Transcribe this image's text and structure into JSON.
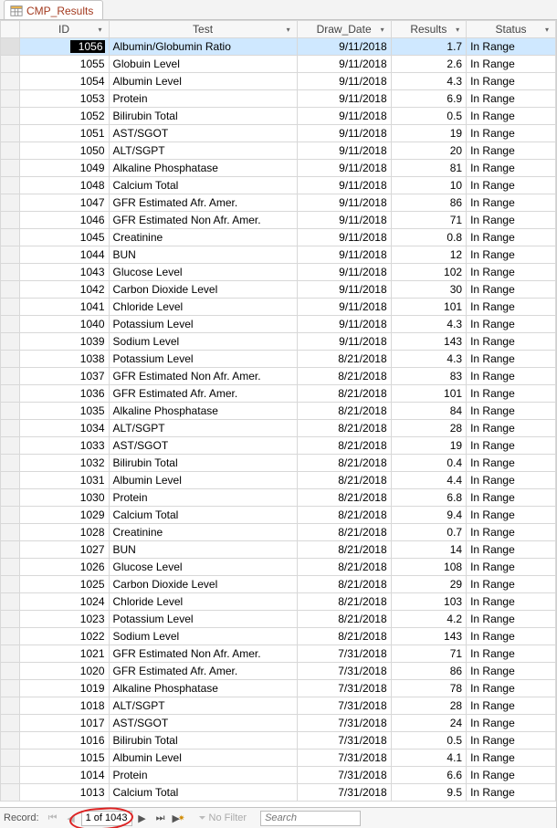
{
  "tab": {
    "title": "CMP_Results"
  },
  "columns": [
    "ID",
    "Test",
    "Draw_Date",
    "Results",
    "Status"
  ],
  "rows": [
    {
      "id": "1056",
      "test": "Albumin/Globumin Ratio",
      "date": "9/11/2018",
      "result": "1.7",
      "status": "In Range"
    },
    {
      "id": "1055",
      "test": "Globuin Level",
      "date": "9/11/2018",
      "result": "2.6",
      "status": "In Range"
    },
    {
      "id": "1054",
      "test": "Albumin Level",
      "date": "9/11/2018",
      "result": "4.3",
      "status": "In Range"
    },
    {
      "id": "1053",
      "test": "Protein",
      "date": "9/11/2018",
      "result": "6.9",
      "status": "In Range"
    },
    {
      "id": "1052",
      "test": "Bilirubin Total",
      "date": "9/11/2018",
      "result": "0.5",
      "status": "In Range"
    },
    {
      "id": "1051",
      "test": "AST/SGOT",
      "date": "9/11/2018",
      "result": "19",
      "status": "In Range"
    },
    {
      "id": "1050",
      "test": "ALT/SGPT",
      "date": "9/11/2018",
      "result": "20",
      "status": "In Range"
    },
    {
      "id": "1049",
      "test": "Alkaline Phosphatase",
      "date": "9/11/2018",
      "result": "81",
      "status": "In Range"
    },
    {
      "id": "1048",
      "test": "Calcium Total",
      "date": "9/11/2018",
      "result": "10",
      "status": "In Range"
    },
    {
      "id": "1047",
      "test": "GFR Estimated Afr. Amer.",
      "date": "9/11/2018",
      "result": "86",
      "status": "In Range"
    },
    {
      "id": "1046",
      "test": "GFR Estimated Non Afr. Amer.",
      "date": "9/11/2018",
      "result": "71",
      "status": "In Range"
    },
    {
      "id": "1045",
      "test": "Creatinine",
      "date": "9/11/2018",
      "result": "0.8",
      "status": "In Range"
    },
    {
      "id": "1044",
      "test": "BUN",
      "date": "9/11/2018",
      "result": "12",
      "status": "In Range"
    },
    {
      "id": "1043",
      "test": "Glucose Level",
      "date": "9/11/2018",
      "result": "102",
      "status": "In Range"
    },
    {
      "id": "1042",
      "test": "Carbon Dioxide Level",
      "date": "9/11/2018",
      "result": "30",
      "status": "In Range"
    },
    {
      "id": "1041",
      "test": "Chloride Level",
      "date": "9/11/2018",
      "result": "101",
      "status": "In Range"
    },
    {
      "id": "1040",
      "test": "Potassium Level",
      "date": "9/11/2018",
      "result": "4.3",
      "status": "In Range"
    },
    {
      "id": "1039",
      "test": "Sodium Level",
      "date": "9/11/2018",
      "result": "143",
      "status": "In Range"
    },
    {
      "id": "1038",
      "test": "Potassium Level",
      "date": "8/21/2018",
      "result": "4.3",
      "status": "In Range"
    },
    {
      "id": "1037",
      "test": "GFR Estimated Non Afr. Amer.",
      "date": "8/21/2018",
      "result": "83",
      "status": "In Range"
    },
    {
      "id": "1036",
      "test": "GFR Estimated Afr. Amer.",
      "date": "8/21/2018",
      "result": "101",
      "status": "In Range"
    },
    {
      "id": "1035",
      "test": "Alkaline Phosphatase",
      "date": "8/21/2018",
      "result": "84",
      "status": "In Range"
    },
    {
      "id": "1034",
      "test": "ALT/SGPT",
      "date": "8/21/2018",
      "result": "28",
      "status": "In Range"
    },
    {
      "id": "1033",
      "test": "AST/SGOT",
      "date": "8/21/2018",
      "result": "19",
      "status": "In Range"
    },
    {
      "id": "1032",
      "test": "Bilirubin Total",
      "date": "8/21/2018",
      "result": "0.4",
      "status": "In Range"
    },
    {
      "id": "1031",
      "test": "Albumin Level",
      "date": "8/21/2018",
      "result": "4.4",
      "status": "In Range"
    },
    {
      "id": "1030",
      "test": "Protein",
      "date": "8/21/2018",
      "result": "6.8",
      "status": "In Range"
    },
    {
      "id": "1029",
      "test": "Calcium Total",
      "date": "8/21/2018",
      "result": "9.4",
      "status": "In Range"
    },
    {
      "id": "1028",
      "test": "Creatinine",
      "date": "8/21/2018",
      "result": "0.7",
      "status": "In Range"
    },
    {
      "id": "1027",
      "test": "BUN",
      "date": "8/21/2018",
      "result": "14",
      "status": "In Range"
    },
    {
      "id": "1026",
      "test": "Glucose Level",
      "date": "8/21/2018",
      "result": "108",
      "status": "In Range"
    },
    {
      "id": "1025",
      "test": "Carbon Dioxide Level",
      "date": "8/21/2018",
      "result": "29",
      "status": "In Range"
    },
    {
      "id": "1024",
      "test": "Chloride Level",
      "date": "8/21/2018",
      "result": "103",
      "status": "In Range"
    },
    {
      "id": "1023",
      "test": "Potassium Level",
      "date": "8/21/2018",
      "result": "4.2",
      "status": "In Range"
    },
    {
      "id": "1022",
      "test": "Sodium Level",
      "date": "8/21/2018",
      "result": "143",
      "status": "In Range"
    },
    {
      "id": "1021",
      "test": "GFR Estimated Non Afr. Amer.",
      "date": "7/31/2018",
      "result": "71",
      "status": "In Range"
    },
    {
      "id": "1020",
      "test": "GFR Estimated Afr. Amer.",
      "date": "7/31/2018",
      "result": "86",
      "status": "In Range"
    },
    {
      "id": "1019",
      "test": "Alkaline Phosphatase",
      "date": "7/31/2018",
      "result": "78",
      "status": "In Range"
    },
    {
      "id": "1018",
      "test": "ALT/SGPT",
      "date": "7/31/2018",
      "result": "28",
      "status": "In Range"
    },
    {
      "id": "1017",
      "test": "AST/SGOT",
      "date": "7/31/2018",
      "result": "24",
      "status": "In Range"
    },
    {
      "id": "1016",
      "test": "Bilirubin Total",
      "date": "7/31/2018",
      "result": "0.5",
      "status": "In Range"
    },
    {
      "id": "1015",
      "test": "Albumin Level",
      "date": "7/31/2018",
      "result": "4.1",
      "status": "In Range"
    },
    {
      "id": "1014",
      "test": "Protein",
      "date": "7/31/2018",
      "result": "6.6",
      "status": "In Range"
    },
    {
      "id": "1013",
      "test": "Calcium Total",
      "date": "7/31/2018",
      "result": "9.5",
      "status": "In Range"
    }
  ],
  "nav": {
    "record_label": "Record:",
    "position": "1 of 1043",
    "filter_label": "No Filter",
    "search_placeholder": "Search"
  }
}
